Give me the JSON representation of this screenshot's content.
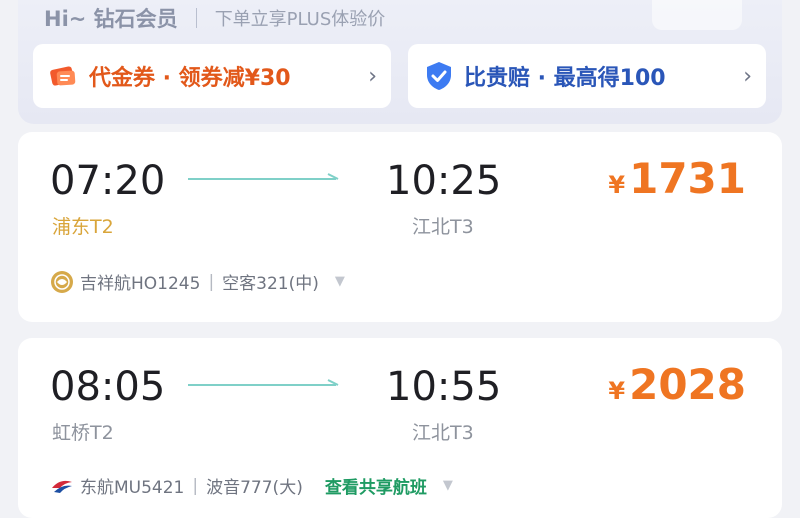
{
  "member": {
    "greeting": "Hi~ 钻石会员",
    "subtitle": "下单立享PLUS体验价",
    "promos": [
      {
        "icon": "coupon-icon",
        "text": "代金券 · 领券减¥30"
      },
      {
        "icon": "shield-check-icon",
        "text": "比贵赔 · 最高得100"
      }
    ]
  },
  "flights": [
    {
      "dep_time": "07:20",
      "dep_airport": "浦东T2",
      "dep_airport_color": "#d9a53a",
      "arr_time": "10:25",
      "arr_airport": "江北T3",
      "price_symbol": "¥",
      "price": "1731",
      "airline": "吉祥航HO1245",
      "aircraft": "空客321(中)",
      "codeshare": ""
    },
    {
      "dep_time": "08:05",
      "dep_airport": "虹桥T2",
      "dep_airport_color": "#8e939d",
      "arr_time": "10:55",
      "arr_airport": "江北T3",
      "price_symbol": "¥",
      "price": "2028",
      "airline": "东航MU5421",
      "aircraft": "波音777(大)",
      "codeshare": "查看共享航班"
    }
  ],
  "colors": {
    "price": "#ef7522",
    "arrow": "#7fd0c8",
    "codeshare": "#1f9b63"
  }
}
